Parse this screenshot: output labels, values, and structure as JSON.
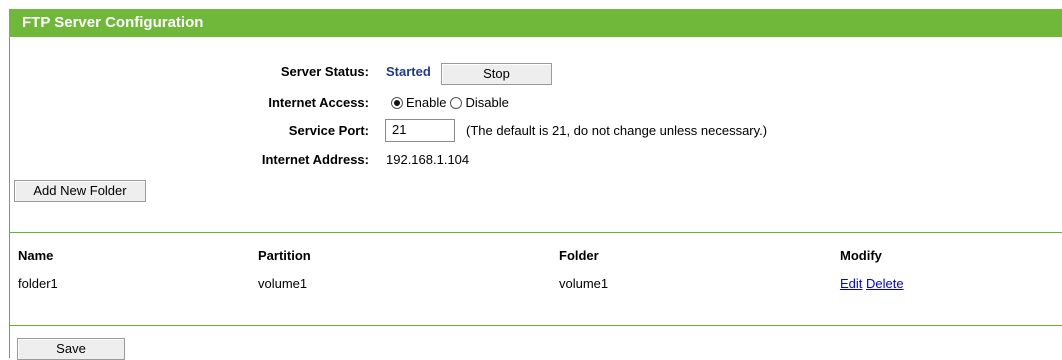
{
  "header": {
    "title": "FTP Server Configuration"
  },
  "server_status": {
    "label": "Server Status:",
    "value": "Started",
    "button_label": "Stop"
  },
  "internet_access": {
    "label": "Internet Access:",
    "options": [
      "Enable",
      "Disable"
    ],
    "selected": "Enable"
  },
  "service_port": {
    "label": "Service Port:",
    "value": "21",
    "hint": "(The default is 21, do not change unless necessary.)"
  },
  "internet_address": {
    "label": "Internet Address:",
    "value": "192.168.1.104"
  },
  "add_folder_button": "Add New Folder",
  "table": {
    "headers": [
      "Name",
      "Partition",
      "Folder",
      "Modify"
    ],
    "rows": [
      {
        "name": "folder1",
        "partition": "volume1",
        "folder": "volume1",
        "actions": [
          "Edit",
          "Delete"
        ]
      }
    ]
  },
  "save_button": "Save",
  "colors": {
    "accent": "#6fb83a",
    "status_text": "#1f3a8a",
    "link": "#0000ee"
  }
}
